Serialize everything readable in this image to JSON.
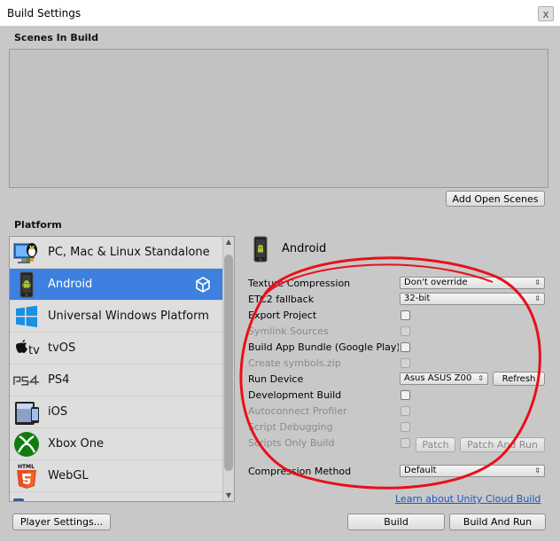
{
  "window": {
    "title": "Build Settings",
    "close_glyph": "x"
  },
  "scenes": {
    "header": "Scenes In Build",
    "add_open_scenes_label": "Add Open Scenes"
  },
  "platform": {
    "header": "Platform",
    "items": [
      {
        "label": "PC, Mac & Linux Standalone",
        "icon": "pc-mac-linux-icon"
      },
      {
        "label": "Android",
        "icon": "android-icon",
        "selected": true,
        "active_icon": "unity-logo-icon"
      },
      {
        "label": "Universal Windows Platform",
        "icon": "windows-icon"
      },
      {
        "label": "tvOS",
        "icon": "apple-tv-icon"
      },
      {
        "label": "PS4",
        "icon": "ps4-icon"
      },
      {
        "label": "iOS",
        "icon": "ios-icon"
      },
      {
        "label": "Xbox One",
        "icon": "xbox-icon"
      },
      {
        "label": "WebGL",
        "icon": "html5-icon"
      }
    ]
  },
  "settings": {
    "platform_title": "Android",
    "texture_compression": {
      "label": "Texture Compression",
      "value": "Don't override"
    },
    "etc2_fallback": {
      "label": "ETC2 fallback",
      "value": "32-bit"
    },
    "export_project": {
      "label": "Export Project"
    },
    "symlink_sources": {
      "label": "Symlink Sources"
    },
    "build_app_bundle": {
      "label": "Build App Bundle (Google Play)"
    },
    "create_symbols": {
      "label": "Create symbols.zip"
    },
    "run_device": {
      "label": "Run Device",
      "value": "Asus ASUS Z00",
      "refresh_label": "Refresh"
    },
    "development_build": {
      "label": "Development Build"
    },
    "autoconnect_profiler": {
      "label": "Autoconnect Profiler"
    },
    "script_debugging": {
      "label": "Script Debugging"
    },
    "scripts_only_build": {
      "label": "Scripts Only Build",
      "patch_label": "Patch",
      "patch_and_run_label": "Patch And Run"
    },
    "compression_method": {
      "label": "Compression Method",
      "value": "Default"
    }
  },
  "footer": {
    "cloud_build_link": "Learn about Unity Cloud Build",
    "player_settings_label": "Player Settings...",
    "build_label": "Build",
    "build_and_run_label": "Build And Run"
  },
  "colors": {
    "selection": "#3d80df",
    "annotation_ellipse": "#e8101a",
    "link": "#1b55c9"
  }
}
